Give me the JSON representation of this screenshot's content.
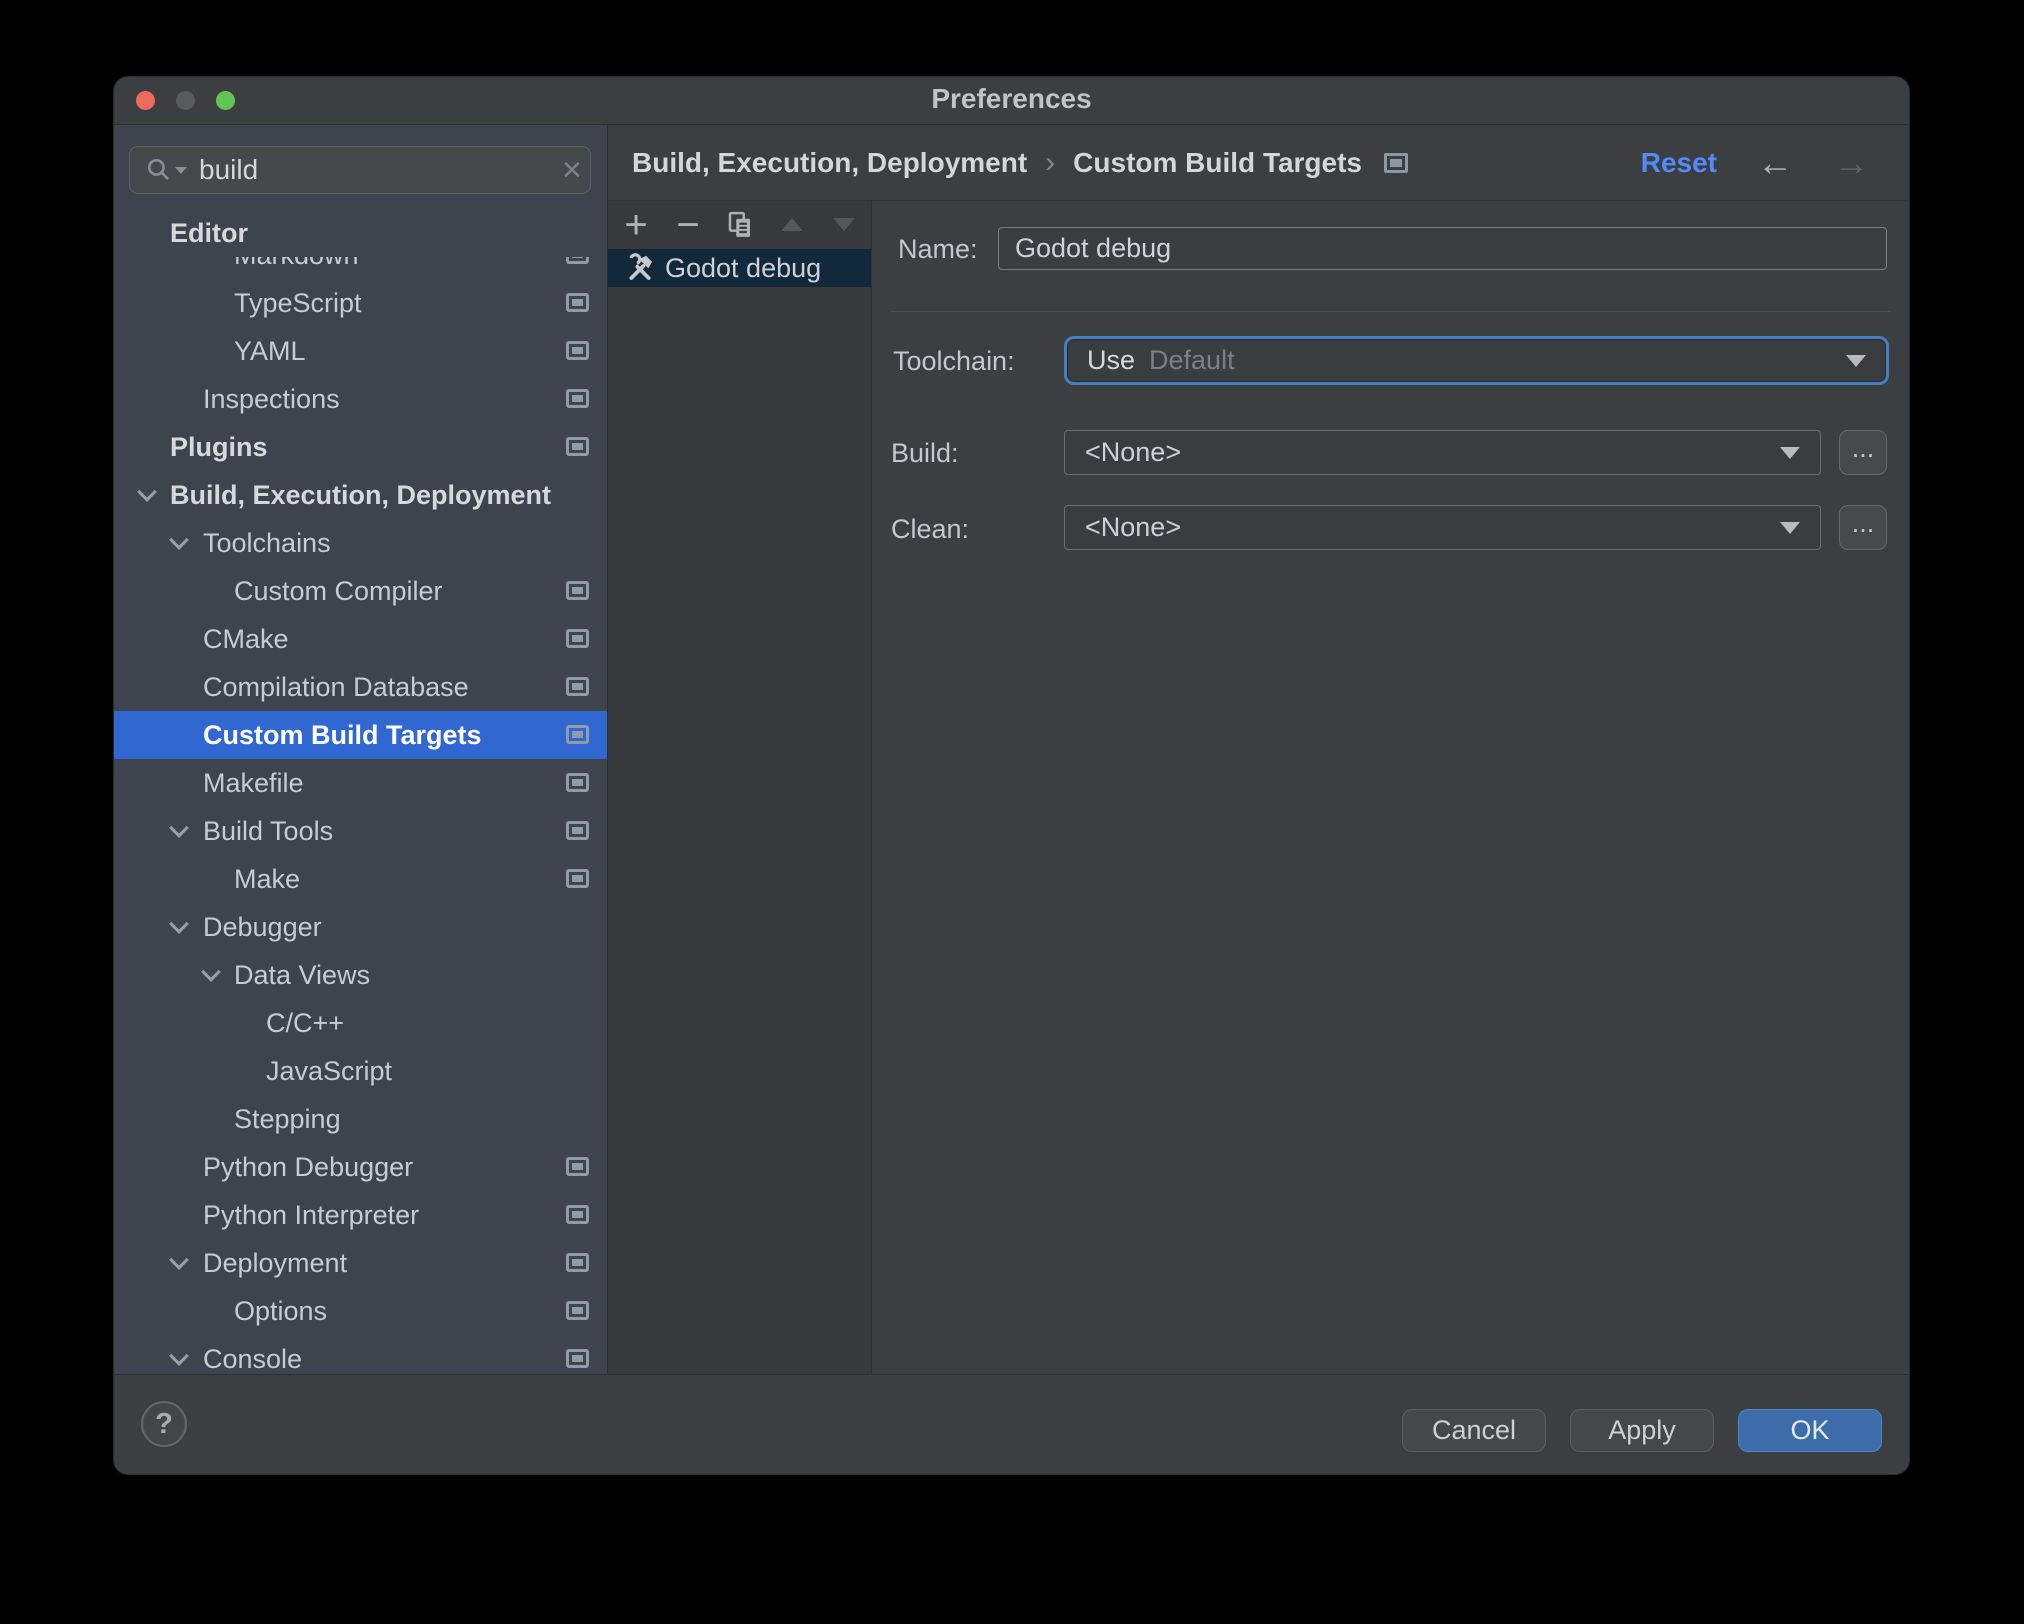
{
  "window": {
    "title": "Preferences"
  },
  "search": {
    "value": "build",
    "clear_glyph": "×"
  },
  "sidebar": {
    "items": [
      {
        "label": "Editor"
      },
      {
        "label": "Markdown"
      },
      {
        "label": "TypeScript"
      },
      {
        "label": "YAML"
      },
      {
        "label": "Inspections"
      },
      {
        "label": "Plugins"
      },
      {
        "label": "Build, Execution, Deployment"
      },
      {
        "label": "Toolchains"
      },
      {
        "label": "Custom Compiler"
      },
      {
        "label": "CMake"
      },
      {
        "label": "Compilation Database"
      },
      {
        "label": "Custom Build Targets"
      },
      {
        "label": "Makefile"
      },
      {
        "label": "Build Tools"
      },
      {
        "label": "Make"
      },
      {
        "label": "Debugger"
      },
      {
        "label": "Data Views"
      },
      {
        "label": "C/C++"
      },
      {
        "label": "JavaScript"
      },
      {
        "label": "Stepping"
      },
      {
        "label": "Python Debugger"
      },
      {
        "label": "Python Interpreter"
      },
      {
        "label": "Deployment"
      },
      {
        "label": "Options"
      },
      {
        "label": "Console"
      }
    ]
  },
  "breadcrumb": {
    "section": "Build, Execution, Deployment",
    "separator": "›",
    "page": "Custom Build Targets"
  },
  "header": {
    "reset": "Reset",
    "back_glyph": "←",
    "forward_glyph": "→"
  },
  "list_toolbar": {
    "add_glyph": "+",
    "remove_glyph": "−"
  },
  "targets": {
    "items": [
      {
        "label": "Godot debug"
      }
    ]
  },
  "form": {
    "name_label": "Name:",
    "name_value": "Godot debug",
    "toolchain_label": "Toolchain:",
    "toolchain_use": "Use",
    "toolchain_value": "Default",
    "build_label": "Build:",
    "build_value": "<None>",
    "clean_label": "Clean:",
    "clean_value": "<None>",
    "more_label": "..."
  },
  "footer": {
    "help": "?",
    "cancel": "Cancel",
    "apply": "Apply",
    "ok": "OK"
  },
  "colors": {
    "sidebar_selection": "#3067D1",
    "list_selection": "#12293C",
    "reset_link": "#548AF7",
    "ok_button": "#3D6CAB",
    "focus_ring": "#4A7CC2",
    "sidebar_bg": "#3E434D",
    "panel_bg": "#3C3F41",
    "list_panel_bg": "#37393D"
  }
}
